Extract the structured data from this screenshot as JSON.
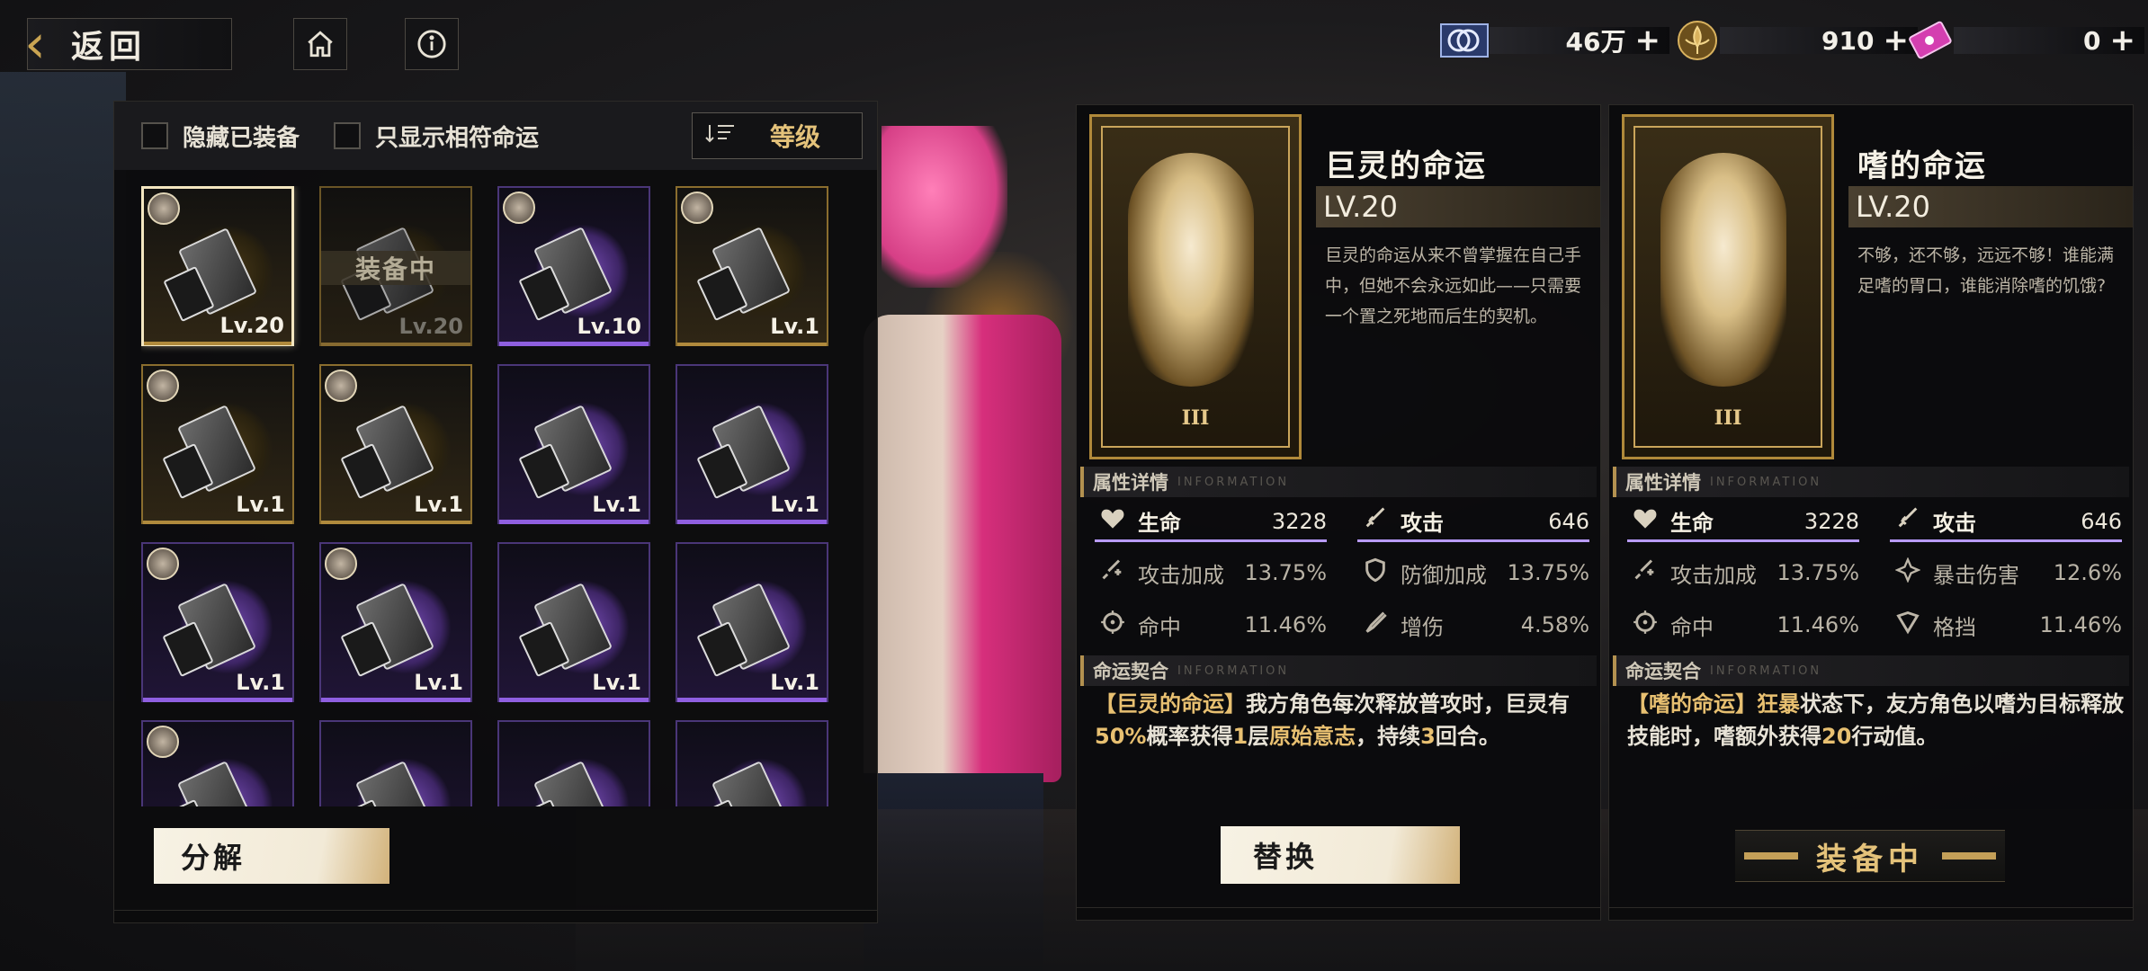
{
  "header": {
    "back_label": "返回",
    "home_icon": "home-icon",
    "info_icon": "info-icon"
  },
  "currencies": [
    {
      "icon": "currency-coin-icon",
      "value": "46万",
      "plus": "+"
    },
    {
      "icon": "currency-fleur-icon",
      "value": "910",
      "plus": "+"
    },
    {
      "icon": "currency-ticket-icon",
      "value": "0",
      "plus": "+"
    }
  ],
  "filters": {
    "hide_equipped": "隐藏已装备",
    "show_matching": "只显示相符命运",
    "sort_label": "等级"
  },
  "cards": [
    {
      "level": "Lv.20",
      "rarity": "gold",
      "selected": true,
      "avatar": true
    },
    {
      "level": "Lv.20",
      "rarity": "gold",
      "equipped_tag": "装备中",
      "dim": true
    },
    {
      "level": "Lv.10",
      "rarity": "purple",
      "avatar": true
    },
    {
      "level": "Lv.1",
      "rarity": "gold",
      "avatar": true
    },
    {
      "level": "Lv.1",
      "rarity": "gold",
      "avatar": true
    },
    {
      "level": "Lv.1",
      "rarity": "gold",
      "avatar": true
    },
    {
      "level": "Lv.1",
      "rarity": "purple"
    },
    {
      "level": "Lv.1",
      "rarity": "purple"
    },
    {
      "level": "Lv.1",
      "rarity": "purple",
      "avatar": true
    },
    {
      "level": "Lv.1",
      "rarity": "purple",
      "avatar": true
    },
    {
      "level": "Lv.1",
      "rarity": "purple"
    },
    {
      "level": "Lv.1",
      "rarity": "purple"
    },
    {
      "level": "",
      "rarity": "purple",
      "avatar": true
    },
    {
      "level": "",
      "rarity": "purple"
    },
    {
      "level": "",
      "rarity": "purple"
    },
    {
      "level": "",
      "rarity": "purple"
    }
  ],
  "decompose_label": "分解",
  "destinies": [
    {
      "name": "巨灵的命运",
      "level": "LV.20",
      "card_numeral": "III",
      "description": "巨灵的命运从来不曾掌握在自己手中，但她不会永远如此——只需要一个置之死地而后生的契机。",
      "section_stats": "属性详情",
      "section_pact": "命运契合",
      "section_sub": "INFORMATION",
      "main_stats": [
        {
          "icon": "heart-icon",
          "label": "生命",
          "value": "3228"
        },
        {
          "icon": "sword-icon",
          "label": "攻击",
          "value": "646"
        }
      ],
      "sub_stats": [
        {
          "icon": "attack-bonus-icon",
          "label": "攻击加成",
          "value": "13.75%"
        },
        {
          "icon": "defense-bonus-icon",
          "label": "防御加成",
          "value": "13.75%"
        },
        {
          "icon": "target-icon",
          "label": "命中",
          "value": "11.46%"
        },
        {
          "icon": "damage-boost-icon",
          "label": "增伤",
          "value": "4.58%"
        }
      ],
      "pact_parts": [
        {
          "text": "【巨灵的命运】",
          "hl": true
        },
        {
          "text": "我方角色每次释放普攻时，巨灵有",
          "hl": false
        },
        {
          "text": "50%",
          "hl": true
        },
        {
          "text": "概率获得",
          "hl": false
        },
        {
          "text": "1",
          "hl": true
        },
        {
          "text": "层",
          "hl": false
        },
        {
          "text": "原始意志",
          "hl": true
        },
        {
          "text": "，持续",
          "hl": false
        },
        {
          "text": "3",
          "hl": true
        },
        {
          "text": "回合。",
          "hl": false
        }
      ],
      "action_label": "替换"
    },
    {
      "name": "嗜的命运",
      "level": "LV.20",
      "card_numeral": "III",
      "description": "不够，还不够，远远不够！谁能满足嗜的胃口，谁能消除嗜的饥饿?",
      "section_stats": "属性详情",
      "section_pact": "命运契合",
      "section_sub": "INFORMATION",
      "main_stats": [
        {
          "icon": "heart-icon",
          "label": "生命",
          "value": "3228"
        },
        {
          "icon": "sword-icon",
          "label": "攻击",
          "value": "646"
        }
      ],
      "sub_stats": [
        {
          "icon": "attack-bonus-icon",
          "label": "攻击加成",
          "value": "13.75%"
        },
        {
          "icon": "crit-damage-icon",
          "label": "暴击伤害",
          "value": "12.6%"
        },
        {
          "icon": "target-icon",
          "label": "命中",
          "value": "11.46%"
        },
        {
          "icon": "block-icon",
          "label": "格挡",
          "value": "11.46%"
        }
      ],
      "pact_parts": [
        {
          "text": "【嗜的命运】",
          "hl": true
        },
        {
          "text": "狂暴",
          "hl": true
        },
        {
          "text": "状态下，友方角色以嗜为目标释放技能时，嗜额外获得",
          "hl": false
        },
        {
          "text": "20",
          "hl": true
        },
        {
          "text": "行动值。",
          "hl": false
        }
      ],
      "action_label": "装备中"
    }
  ],
  "colors": {
    "accent_gold": "#e4c27a",
    "purple": "#8f5fe0"
  }
}
